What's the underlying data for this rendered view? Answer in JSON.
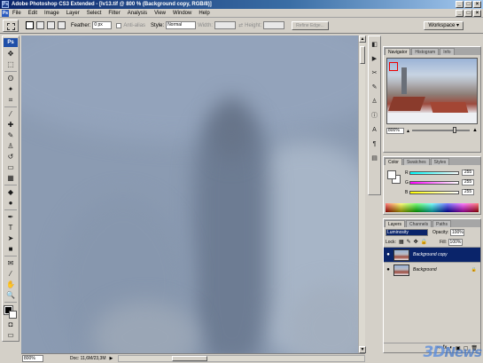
{
  "window": {
    "title": "Adobe Photoshop CS3 Extended - [lv13.tif @ 800 % (Background copy, RGB/8)]",
    "app_badge": "Ps",
    "controls": [
      "_",
      "□",
      "×"
    ]
  },
  "menu": {
    "items": [
      "File",
      "Edit",
      "Image",
      "Layer",
      "Select",
      "Filter",
      "Analysis",
      "View",
      "Window",
      "Help"
    ],
    "doc_controls": [
      "_",
      "□",
      "×"
    ]
  },
  "options_bar": {
    "feather_label": "Feather:",
    "feather_value": "0 px",
    "anti_alias_label": "Anti-alias",
    "style_label": "Style:",
    "style_value": "Normal",
    "width_label": "Width:",
    "height_label": "Height:",
    "refine_edge_label": "Refine Edge...",
    "workspace_label": "Workspace"
  },
  "toolbox": {
    "badge": "Ps",
    "tools": [
      {
        "name": "move-tool",
        "glyph": "✥"
      },
      {
        "name": "marquee-tool",
        "glyph": "⬚"
      },
      {
        "name": "lasso-tool",
        "glyph": "ʘ"
      },
      {
        "name": "magic-wand-tool",
        "glyph": "✦"
      },
      {
        "name": "crop-tool",
        "glyph": "⌗"
      },
      {
        "name": "eyedropper-tool",
        "glyph": "⁄"
      },
      {
        "name": "healing-brush-tool",
        "glyph": "✚"
      },
      {
        "name": "brush-tool",
        "glyph": "✎"
      },
      {
        "name": "clone-stamp-tool",
        "glyph": "♙"
      },
      {
        "name": "history-brush-tool",
        "glyph": "↺"
      },
      {
        "name": "eraser-tool",
        "glyph": "▭"
      },
      {
        "name": "gradient-tool",
        "glyph": "▦"
      },
      {
        "name": "blur-tool",
        "glyph": "◆"
      },
      {
        "name": "dodge-tool",
        "glyph": "●"
      },
      {
        "name": "pen-tool",
        "glyph": "✒"
      },
      {
        "name": "type-tool",
        "glyph": "T"
      },
      {
        "name": "path-selection-tool",
        "glyph": "➤"
      },
      {
        "name": "shape-tool",
        "glyph": "■"
      },
      {
        "name": "notes-tool",
        "glyph": "✉"
      },
      {
        "name": "eyedropper-sample-tool",
        "glyph": "⁄"
      },
      {
        "name": "hand-tool",
        "glyph": "✋"
      },
      {
        "name": "zoom-tool",
        "glyph": "🔍"
      }
    ],
    "extra": [
      {
        "name": "quick-mask-icon",
        "glyph": "◘"
      },
      {
        "name": "screen-mode-icon",
        "glyph": "▭"
      }
    ]
  },
  "status_bar": {
    "zoom": "800%",
    "doc_info": "Doc: 11,6M/23,3M",
    "arrow": "▶"
  },
  "dock": {
    "icons": [
      {
        "name": "history-dock-icon",
        "glyph": "◧"
      },
      {
        "name": "actions-dock-icon",
        "glyph": "▶"
      },
      {
        "name": "tool-presets-dock-icon",
        "glyph": "✂"
      },
      {
        "name": "brushes-dock-icon",
        "glyph": "✎"
      },
      {
        "name": "clone-source-dock-icon",
        "glyph": "♙"
      },
      {
        "name": "info-dock-icon",
        "glyph": "ⓘ"
      },
      {
        "name": "character-dock-icon",
        "glyph": "A"
      },
      {
        "name": "paragraph-dock-icon",
        "glyph": "¶"
      },
      {
        "name": "layer-comps-dock-icon",
        "glyph": "▤"
      }
    ]
  },
  "navigator": {
    "tabs": [
      "Navigator",
      "Histogram",
      "Info"
    ],
    "zoom": "800%"
  },
  "color_panel": {
    "tabs": [
      "Color",
      "Swatches",
      "Styles"
    ],
    "channels": [
      {
        "label": "R",
        "value": "255",
        "gradient": "linear-gradient(to right,#00ffff,#ffffff)"
      },
      {
        "label": "G",
        "value": "255",
        "gradient": "linear-gradient(to right,#ff00ff,#ffffff)"
      },
      {
        "label": "B",
        "value": "255",
        "gradient": "linear-gradient(to right,#ffff00,#ffffff)"
      }
    ]
  },
  "layers_panel": {
    "tabs": [
      "Layers",
      "Channels",
      "Paths"
    ],
    "blend_mode": "Luminosity",
    "opacity_label": "Opacity:",
    "opacity_value": "100%",
    "lock_label": "Lock:",
    "fill_label": "Fill:",
    "fill_value": "100%",
    "layers": [
      {
        "name": "Background copy",
        "selected": true
      },
      {
        "name": "Background",
        "selected": false
      }
    ],
    "footer_icons": [
      "∞",
      "fx",
      "◐",
      "▣",
      "▢",
      "🗑"
    ]
  },
  "watermark": {
    "prefix": "3D",
    "suffix": "News"
  },
  "colors": {
    "titlebar_start": "#0a246a",
    "canvas": "#8b9bb2",
    "selection": "#0a246a"
  }
}
